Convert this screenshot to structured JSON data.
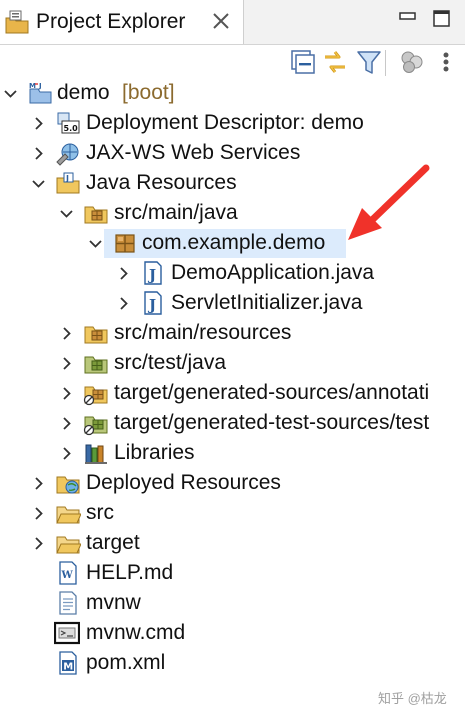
{
  "view": {
    "title": "Project Explorer",
    "close_icon": "close-icon",
    "minimize_icon": "minimize-icon",
    "maximize_icon": "maximize-icon"
  },
  "toolbar": {
    "buttons": [
      "collapse-all-icon",
      "link-with-editor-icon",
      "filter-icon",
      "view-menu-icon"
    ]
  },
  "tree": {
    "project": {
      "name": "demo",
      "decoration": "[boot]",
      "expanded": true,
      "icon": "boot-project-icon"
    },
    "items": [
      {
        "label": "Deployment Descriptor: demo",
        "icon": "deployment-descriptor-icon",
        "expanded": false
      },
      {
        "label": "JAX-WS Web Services",
        "icon": "web-services-icon",
        "expanded": false
      },
      {
        "label": "Java Resources",
        "icon": "java-resources-icon",
        "expanded": true
      },
      {
        "label": "src/main/java",
        "icon": "source-folder-icon",
        "expanded": true
      },
      {
        "label": "com.example.demo",
        "icon": "package-icon",
        "expanded": true,
        "selected": true
      },
      {
        "label": "DemoApplication.java",
        "icon": "java-file-icon",
        "expanded": false
      },
      {
        "label": "ServletInitializer.java",
        "icon": "java-file-icon",
        "expanded": false
      },
      {
        "label": "src/main/resources",
        "icon": "source-folder-icon",
        "expanded": false
      },
      {
        "label": "src/test/java",
        "icon": "test-source-folder-icon",
        "expanded": false
      },
      {
        "label": "target/generated-sources/annotati",
        "icon": "generated-source-folder-icon",
        "expanded": false
      },
      {
        "label": "target/generated-test-sources/test",
        "icon": "generated-test-source-folder-icon",
        "expanded": false
      },
      {
        "label": "Libraries",
        "icon": "libraries-icon",
        "expanded": false
      },
      {
        "label": "Deployed Resources",
        "icon": "deployed-resources-icon",
        "expanded": false
      },
      {
        "label": "src",
        "icon": "folder-icon",
        "expanded": false
      },
      {
        "label": "target",
        "icon": "folder-icon",
        "expanded": false
      },
      {
        "label": "HELP.md",
        "icon": "markdown-file-icon"
      },
      {
        "label": "mvnw",
        "icon": "text-file-icon"
      },
      {
        "label": "mvnw.cmd",
        "icon": "cmd-file-icon"
      },
      {
        "label": "pom.xml",
        "icon": "maven-pom-icon"
      }
    ]
  },
  "annotation": {
    "arrow_color": "#f0322a",
    "icon": "red-arrow-icon"
  },
  "watermark": "知乎 @枯龙",
  "colors": {
    "selection": "#dcebfc",
    "decoration": "#8b6a2e",
    "folder": "#e8b54a",
    "java_blue": "#2b5f9e"
  }
}
